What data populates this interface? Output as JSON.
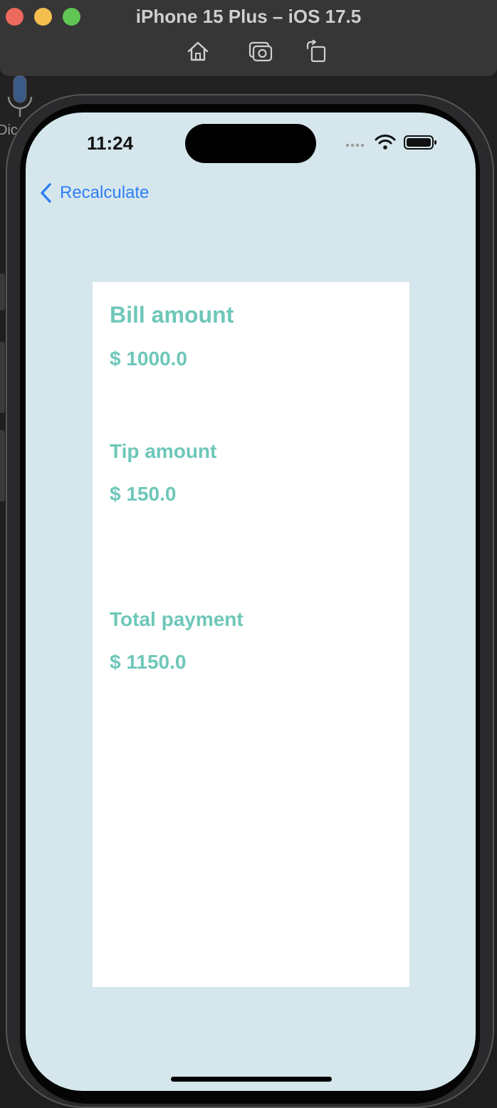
{
  "window": {
    "title": "iPhone 15 Plus – iOS 17.5",
    "dictation_label": "Dic"
  },
  "status_bar": {
    "time": "11:24"
  },
  "nav": {
    "back_label": "Recalculate"
  },
  "result": {
    "bill_label": "Bill amount",
    "bill_value": "$ 1000.0",
    "tip_label": "Tip amount",
    "tip_value": "$ 150.0",
    "total_label": "Total payment",
    "total_value": "$ 1150.0"
  },
  "colors": {
    "accent_teal": "#6ec7b9",
    "link_blue": "#2f7df6",
    "screen_background": "#d5e7ec"
  }
}
